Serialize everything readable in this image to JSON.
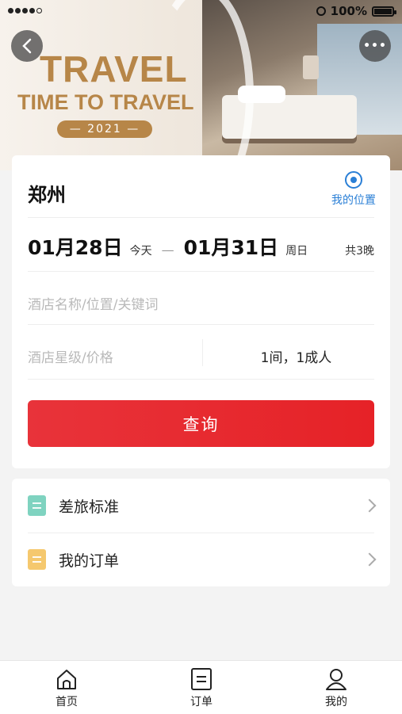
{
  "status_bar": {
    "battery_text": "100%"
  },
  "banner": {
    "title_line1": "TRAVEL",
    "title_line2": "TIME TO TRAVEL",
    "year_badge": "— 2021 —"
  },
  "search": {
    "city": "郑州",
    "my_location_label": "我的位置",
    "checkin_date": "01月28日",
    "checkin_day": "今天",
    "date_separator": "—",
    "checkout_date": "01月31日",
    "checkout_day": "周日",
    "nights": "共3晚",
    "keyword_placeholder": "酒店名称/位置/关键词",
    "star_price_placeholder": "酒店星级/价格",
    "rooms_guests": "1间，1成人",
    "submit_label": "查询"
  },
  "menu": {
    "items": [
      {
        "label": "差旅标准",
        "icon": "travel-standard-icon",
        "color": "#7fd3c0"
      },
      {
        "label": "我的订单",
        "icon": "my-orders-icon",
        "color": "#f5c86e"
      }
    ]
  },
  "tabbar": {
    "items": [
      {
        "label": "首页",
        "icon": "home-icon"
      },
      {
        "label": "订单",
        "icon": "orders-icon"
      },
      {
        "label": "我的",
        "icon": "profile-icon"
      }
    ]
  },
  "colors": {
    "primary_red": "#e62227",
    "accent_blue": "#2a7fd6",
    "banner_gold": "#b78648"
  }
}
